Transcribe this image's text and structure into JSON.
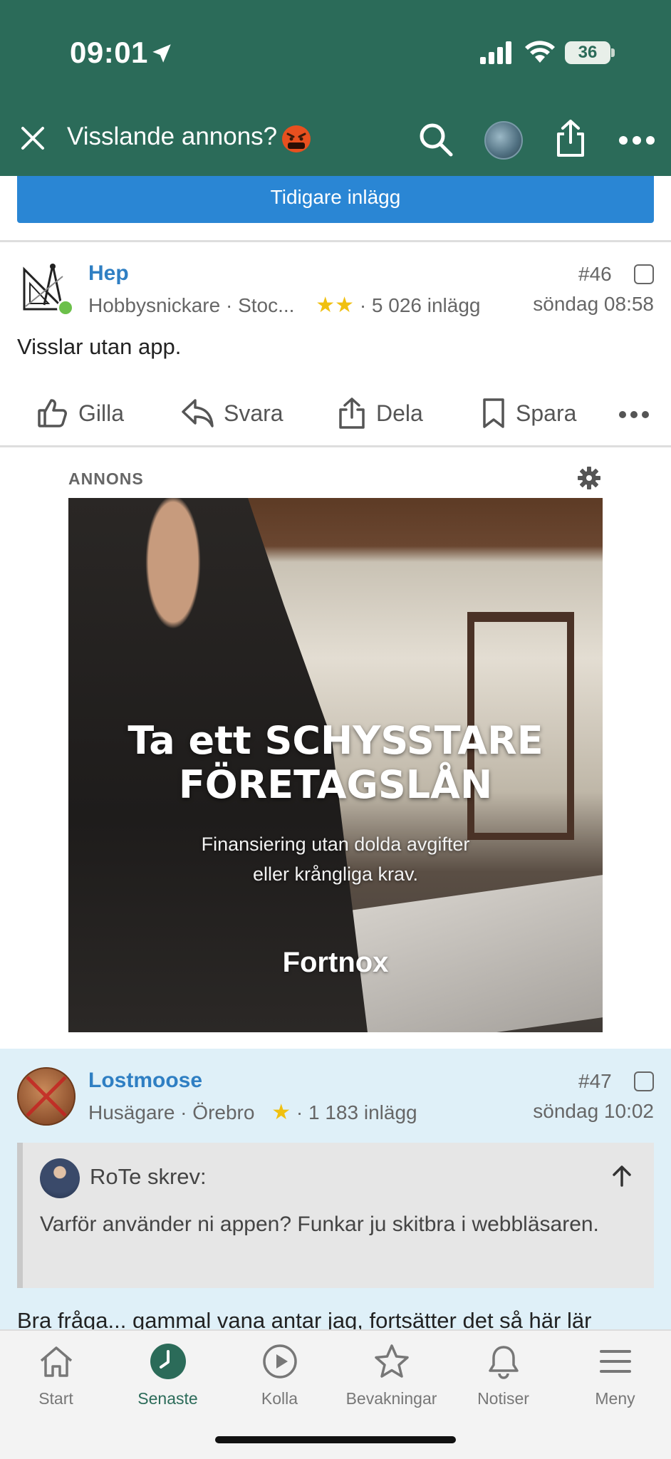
{
  "status_bar": {
    "time": "09:01",
    "battery": "36"
  },
  "header": {
    "title": "Visslande annons?",
    "emoji_icon": "angry-face-emoji-icon"
  },
  "previous_button": {
    "label": "Tidigare inlägg"
  },
  "post46": {
    "username": "Hep",
    "meta_location": "Hobbysnickare · Stoc...",
    "stars": "★★",
    "post_count": "· 5 026 inlägg",
    "number": "#46",
    "date": "söndag 08:58",
    "body": "Visslar utan app."
  },
  "actions": {
    "like": "Gilla",
    "reply": "Svara",
    "share": "Dela",
    "save": "Spara"
  },
  "ad": {
    "label": "ANNONS",
    "headline_line1": "Ta ett SCHYSSTARE",
    "headline_line2": "FÖRETAGSLÅN",
    "subtext_line1": "Finansiering utan dolda avgifter",
    "subtext_line2": "eller krångliga krav.",
    "brand": "Fortnox"
  },
  "post47": {
    "username": "Lostmoose",
    "meta_location": "Husägare · Örebro",
    "stars": "★",
    "post_count": "· 1 183 inlägg",
    "number": "#47",
    "date": "söndag 10:02",
    "quote_author": "RoTe skrev:",
    "quote_text": "Varför använder ni appen? Funkar ju skitbra i webbläsaren.",
    "body": "Bra fråga... gammal vana antar jag, fortsätter det så här lär"
  },
  "bottom_nav": {
    "items": [
      {
        "label": "Start",
        "icon": "home-icon"
      },
      {
        "label": "Senaste",
        "icon": "clock-icon",
        "active": true
      },
      {
        "label": "Kolla",
        "icon": "play-icon"
      },
      {
        "label": "Bevakningar",
        "icon": "star-icon"
      },
      {
        "label": "Notiser",
        "icon": "bell-icon"
      },
      {
        "label": "Meny",
        "icon": "menu-icon"
      }
    ]
  },
  "colors": {
    "header_green": "#2b6b59",
    "link_blue": "#2f7fc3",
    "button_blue": "#2a86d4",
    "highlight_bg": "#dff0f8",
    "star_yellow": "#f0c010"
  }
}
